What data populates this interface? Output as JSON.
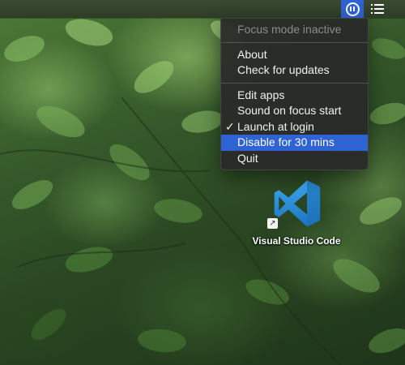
{
  "menubar": {
    "status_items": [
      {
        "icon": "pause-circle-icon",
        "active": true
      },
      {
        "icon": "list-icon",
        "active": false
      }
    ]
  },
  "menu": {
    "status_label": "Focus mode inactive",
    "about_label": "About",
    "updates_label": "Check for updates",
    "edit_apps_label": "Edit apps",
    "sound_label": "Sound on focus start",
    "launch_label": "Launch at login",
    "launch_checked": true,
    "checkmark": "✓",
    "disable_label": "Disable for 30 mins",
    "quit_label": "Quit",
    "highlighted_item": "Disable for 30 mins"
  },
  "desktop": {
    "icon_name": "vscode-icon",
    "icon_label": "Visual Studio Code",
    "alias_arrow": "↗"
  },
  "colors": {
    "accent": "#2f63d3",
    "menu_background": "#282b28",
    "vscode_blue": "#2489ca"
  }
}
